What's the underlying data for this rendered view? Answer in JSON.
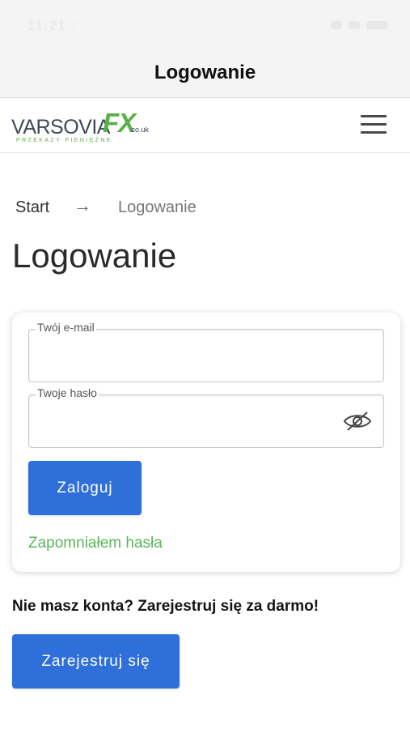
{
  "status_bar": {
    "time": "11:21 ↑"
  },
  "nav": {
    "title": "Logowanie"
  },
  "logo": {
    "main": "VARSOVIA",
    "fx": "FX",
    "tld": ".co.uk",
    "tagline": "PRZEKAZY PIENIĘŻNE"
  },
  "breadcrumb": {
    "home": "Start",
    "separator": "→",
    "current": "Logowanie"
  },
  "page": {
    "title": "Logowanie"
  },
  "login_form": {
    "email_label": "Twój e-mail",
    "email_value": "",
    "password_label": "Twoje hasło",
    "password_value": "",
    "submit_label": "Zaloguj",
    "forgot_label": "Zapomniałem hasła"
  },
  "register": {
    "prompt": "Nie masz konta? Zarejestruj się za darmo!",
    "button_label": "Zarejestruj się"
  },
  "icons": {
    "menu": "hamburger-menu-icon",
    "password_toggle": "eye-slash-icon"
  },
  "colors": {
    "primary_button": "#2e6fd9",
    "link_green": "#5bb55b",
    "brand_green": "#58b047",
    "brand_gray": "#3e4754"
  }
}
